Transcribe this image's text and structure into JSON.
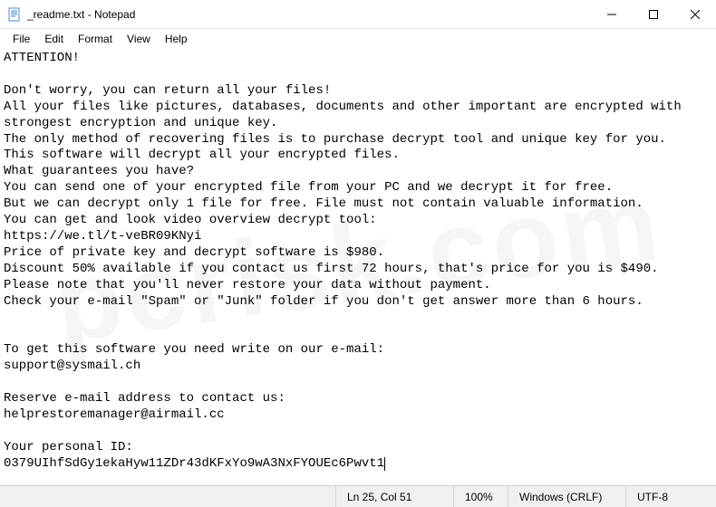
{
  "window": {
    "title": "_readme.txt - Notepad"
  },
  "menubar": {
    "items": [
      "File",
      "Edit",
      "Format",
      "View",
      "Help"
    ]
  },
  "editor": {
    "content": "ATTENTION!\n\nDon't worry, you can return all your files!\nAll your files like pictures, databases, documents and other important are encrypted with strongest encryption and unique key.\nThe only method of recovering files is to purchase decrypt tool and unique key for you.\nThis software will decrypt all your encrypted files.\nWhat guarantees you have?\nYou can send one of your encrypted file from your PC and we decrypt it for free.\nBut we can decrypt only 1 file for free. File must not contain valuable information.\nYou can get and look video overview decrypt tool:\nhttps://we.tl/t-veBR09KNyi\nPrice of private key and decrypt software is $980.\nDiscount 50% available if you contact us first 72 hours, that's price for you is $490.\nPlease note that you'll never restore your data without payment.\nCheck your e-mail \"Spam\" or \"Junk\" folder if you don't get answer more than 6 hours.\n\n\nTo get this software you need write on our e-mail:\nsupport@sysmail.ch\n\nReserve e-mail address to contact us:\nhelprestoremanager@airmail.cc\n\nYour personal ID:\n0379UIhfSdGy1ekaHyw11ZDr43dKFxYo9wA3NxFYOUEc6Pwvt1"
  },
  "statusbar": {
    "position": "Ln 25, Col 51",
    "zoom": "100%",
    "lineending": "Windows (CRLF)",
    "encoding": "UTF-8"
  },
  "watermark": "pcrisk.com"
}
